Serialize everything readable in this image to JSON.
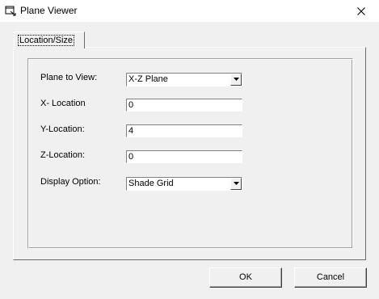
{
  "window": {
    "title": "Plane Viewer",
    "icon": "app-icon",
    "close_icon": "close-icon"
  },
  "tabs": [
    {
      "label": "Location/Size",
      "active": true
    }
  ],
  "form": {
    "plane": {
      "label": "Plane to View:",
      "value": "X-Z Plane"
    },
    "x_location": {
      "label": "X- Location",
      "value": "0"
    },
    "y_location": {
      "label": "Y-Location:",
      "value": "4"
    },
    "z_location": {
      "label": "Z-Location:",
      "value": "0"
    },
    "display": {
      "label": "Display Option:",
      "value": "Shade Grid"
    }
  },
  "buttons": {
    "ok": "OK",
    "cancel": "Cancel"
  }
}
